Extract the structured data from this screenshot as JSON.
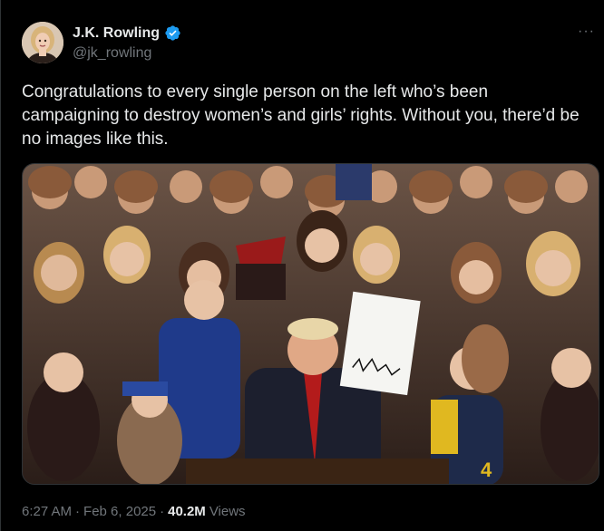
{
  "author": {
    "display_name": "J.K. Rowling",
    "handle": "@jk_rowling",
    "verified": true,
    "verified_icon": "verified-badge-icon",
    "verified_color": "#1d9bf0"
  },
  "more_label": "···",
  "tweet": {
    "text": "Congratulations to every single person on the left who’s been campaigning to destroy women’s and girls’ rights. Without you, there’d be no images like this."
  },
  "meta": {
    "time": "6:27 AM",
    "separator1": "·",
    "date": "Feb 6, 2025",
    "separator2": "·",
    "views_count": "40.2M",
    "views_label": "Views"
  },
  "colors": {
    "background": "#000000",
    "text_primary": "#e7e9ea",
    "text_secondary": "#71767b",
    "border": "#2f3336"
  }
}
